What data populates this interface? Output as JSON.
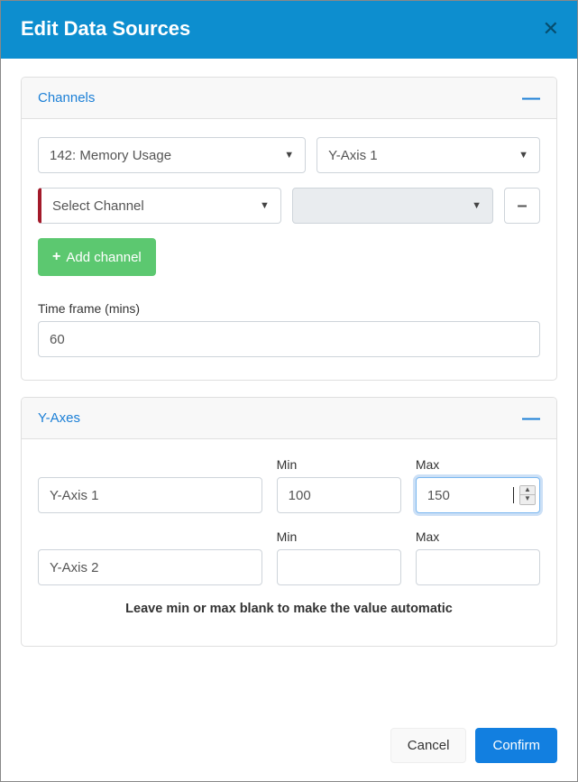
{
  "modal": {
    "title": "Edit Data Sources",
    "close_symbol": "✕"
  },
  "channels_panel": {
    "title": "Channels",
    "rows": [
      {
        "channel": "142: Memory Usage",
        "axis": "Y-Axis 1",
        "disabled": false,
        "accent": false,
        "removable": false
      },
      {
        "channel": "Select Channel",
        "axis": "",
        "disabled": true,
        "accent": true,
        "removable": true
      }
    ],
    "add_label": "Add channel",
    "timeframe_label": "Time frame (mins)",
    "timeframe_value": "60"
  },
  "yaxes_panel": {
    "title": "Y-Axes",
    "min_label": "Min",
    "max_label": "Max",
    "rows": [
      {
        "name": "Y-Axis 1",
        "min": "100",
        "max": "150",
        "max_focused": true
      },
      {
        "name": "Y-Axis 2",
        "min": "",
        "max": "",
        "max_focused": false
      }
    ],
    "hint": "Leave min or max blank to make the value automatic"
  },
  "footer": {
    "cancel": "Cancel",
    "confirm": "Confirm"
  }
}
